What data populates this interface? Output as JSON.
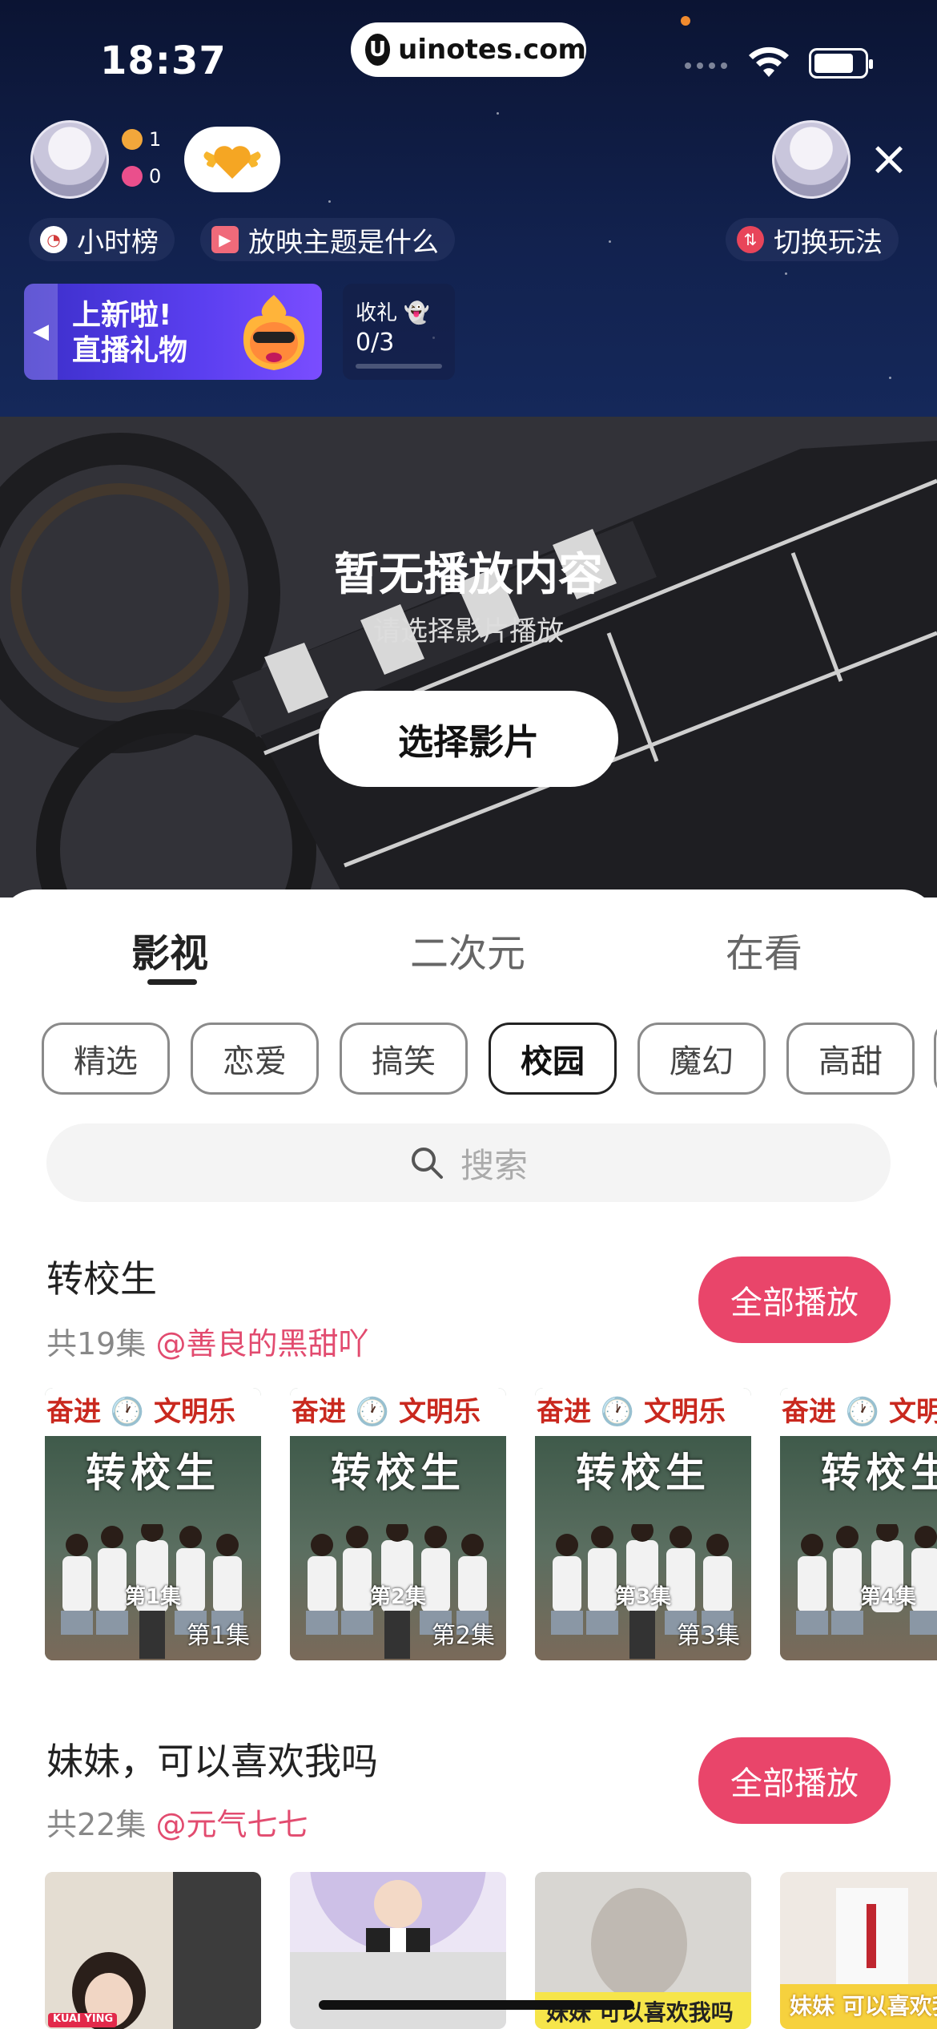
{
  "status_bar": {
    "time": "18:37",
    "url": "uinotes.com"
  },
  "room": {
    "audience_count": "1",
    "like_count": "0",
    "tags": {
      "rank": "小时榜",
      "topic": "放映主题是什么",
      "switch": "切换玩法"
    },
    "banner": {
      "line1": "上新啦!",
      "line2": "直播礼物"
    },
    "gift_task": {
      "label": "收礼",
      "progress": "0/3"
    }
  },
  "hero": {
    "title": "暂无播放内容",
    "subtitle": "请选择影片播放",
    "button": "选择影片"
  },
  "tabs": [
    "影视",
    "二次元",
    "在看"
  ],
  "categories": [
    "精选",
    "恋爱",
    "搞笑",
    "校园",
    "魔幻",
    "高甜"
  ],
  "selected_category": "校园",
  "search_placeholder": "搜索",
  "sections": [
    {
      "title": "转校生",
      "count": "共19集",
      "author": "@善良的黑甜吖",
      "play_all": "全部播放",
      "thumb_banner": "奋进 🕐 文明乐",
      "thumb_title": "转校生",
      "episodes": [
        "第1集",
        "第2集",
        "第3集",
        "第4集"
      ]
    },
    {
      "title": "妹妹，可以喜欢我吗",
      "count": "共22集",
      "author": "@元气七七",
      "play_all": "全部播放",
      "thumb_caption_a": "KUAI YING",
      "thumb_caption_b": "妹妹 可以喜欢我吗",
      "thumb_caption_c": "妹妹 可以喜欢我吗"
    }
  ],
  "colors": {
    "accent": "#e9456a",
    "header_bg": "#0b1433",
    "author": "#e24b6f"
  }
}
